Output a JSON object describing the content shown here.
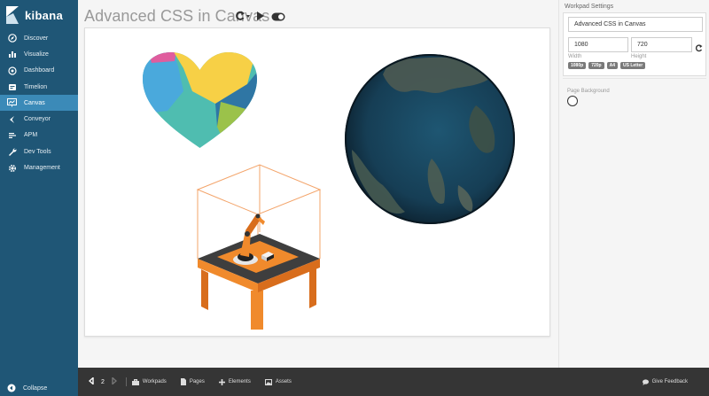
{
  "brand": {
    "name": "kibana"
  },
  "nav": {
    "items": [
      {
        "label": "Discover",
        "icon": "compass-icon"
      },
      {
        "label": "Visualize",
        "icon": "chart-icon"
      },
      {
        "label": "Dashboard",
        "icon": "dashboard-icon"
      },
      {
        "label": "Timelion",
        "icon": "timelion-icon"
      },
      {
        "label": "Canvas",
        "icon": "canvas-icon",
        "active": true
      },
      {
        "label": "Conveyor",
        "icon": "conveyor-icon"
      },
      {
        "label": "APM",
        "icon": "apm-icon"
      },
      {
        "label": "Dev Tools",
        "icon": "wrench-icon"
      },
      {
        "label": "Management",
        "icon": "gear-icon"
      }
    ],
    "collapse_label": "Collapse"
  },
  "workpad": {
    "title": "Advanced CSS in Canvas"
  },
  "settings": {
    "heading": "Workpad Settings",
    "name_value": "Advanced CSS in Canvas",
    "width_value": "1080",
    "height_value": "720",
    "width_label": "Width",
    "height_label": "Height",
    "presets": [
      "1080p",
      "720p",
      "A4",
      "US Letter"
    ],
    "background_label": "Page Background"
  },
  "footer": {
    "page_number": "2",
    "workpads_label": "Workpads",
    "pages_label": "Pages",
    "elements_label": "Elements",
    "assets_label": "Assets",
    "feedback_label": "Give Feedback"
  },
  "colors": {
    "sidebar": "#1f5676",
    "sidebar_active": "#3b8ab8",
    "footer": "#353535",
    "robot_orange": "#f08a2c"
  }
}
